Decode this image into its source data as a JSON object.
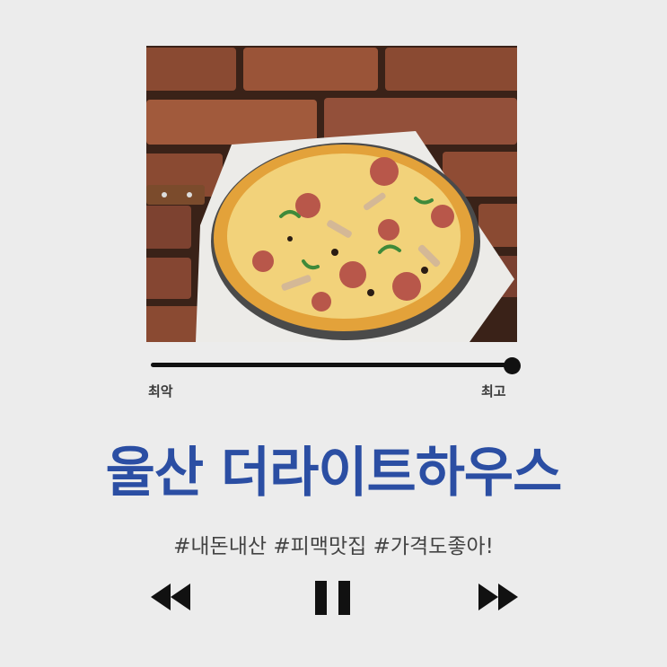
{
  "player": {
    "title": "울산 더라이트하우스",
    "tags": "#내돈내산 #피맥맛집 #가격도좋아!",
    "rating_label_min": "최악",
    "rating_label_max": "최고",
    "rating_value": 1.0
  },
  "photo": {
    "subject": "pizza on brick wall background",
    "colors": {
      "brick": "#8a4a32",
      "mortar": "#3a2218",
      "crust": "#e3a23a",
      "cheese": "#f2d27a"
    }
  },
  "controls": {
    "rewind_icon": "rewind-icon",
    "pause_icon": "pause-icon",
    "forward_icon": "fast-forward-icon"
  },
  "theme": {
    "accent": "#2b4ea3",
    "background": "#ececec",
    "ink": "#111111"
  }
}
